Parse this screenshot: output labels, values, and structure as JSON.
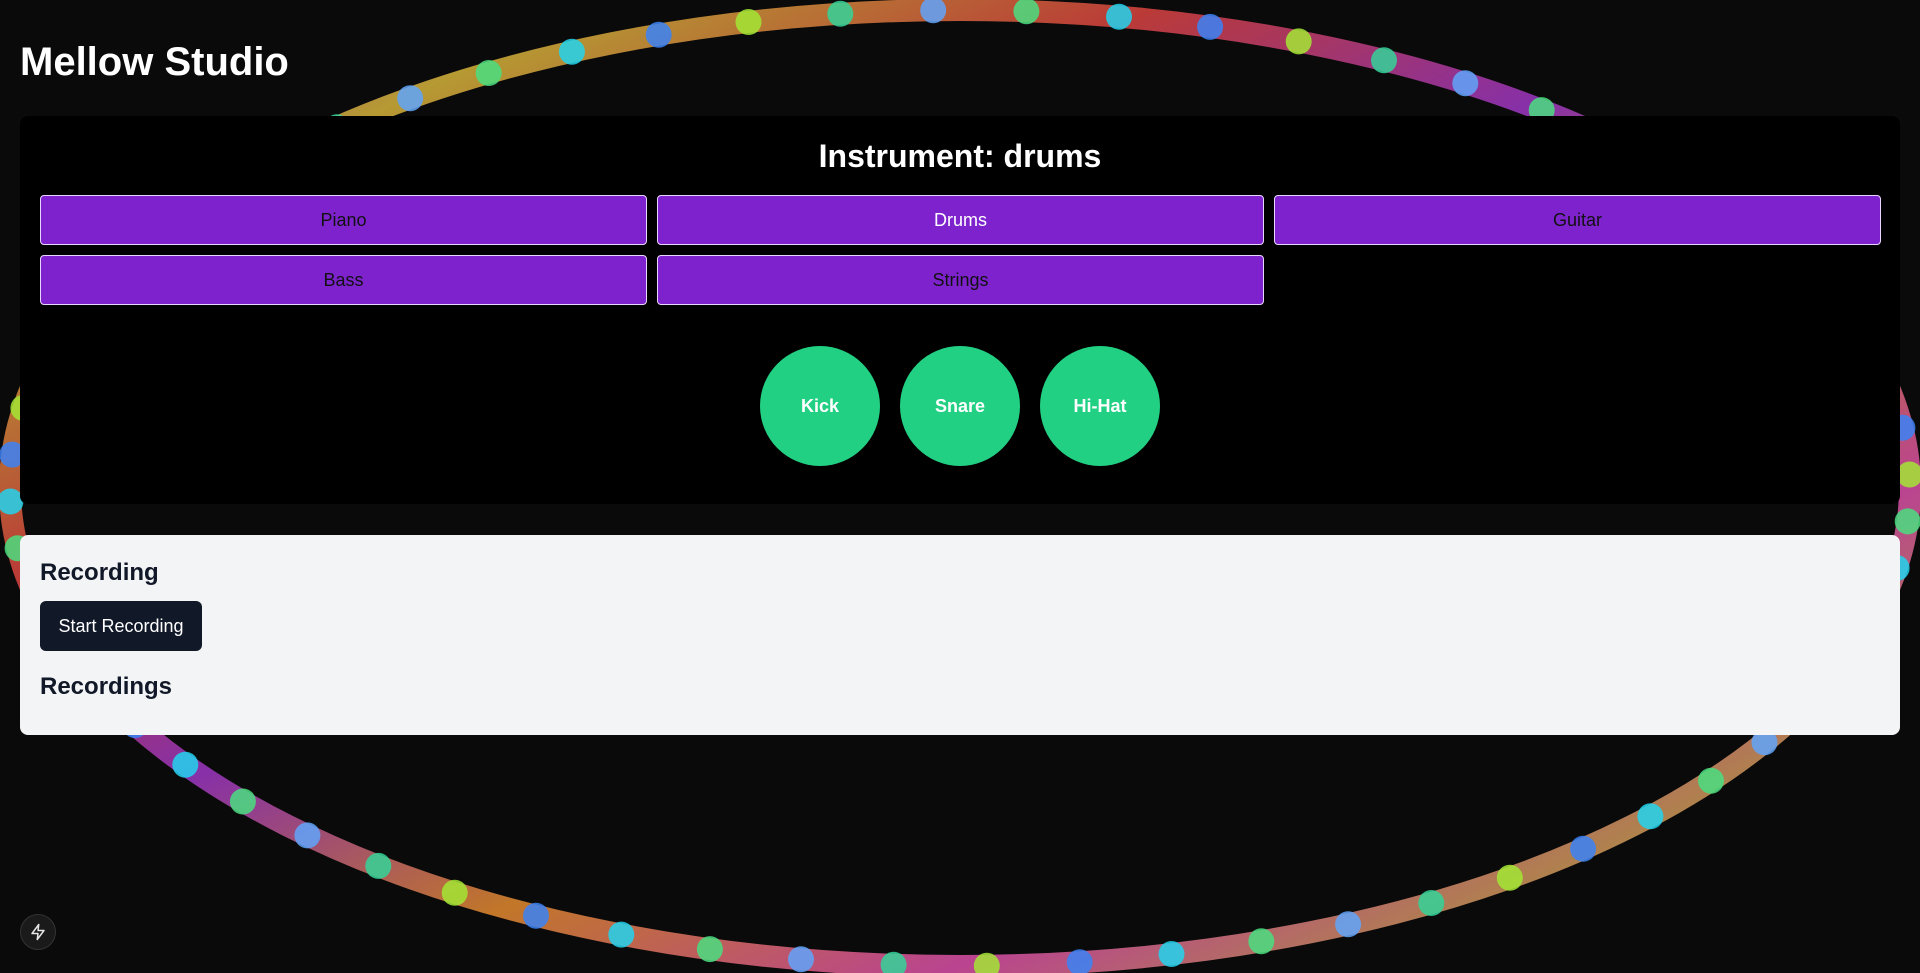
{
  "app": {
    "title": "Mellow Studio"
  },
  "instrument_panel": {
    "heading": "Instrument: drums",
    "selected": "Drums",
    "buttons": [
      {
        "label": "Piano"
      },
      {
        "label": "Drums"
      },
      {
        "label": "Guitar"
      },
      {
        "label": "Bass"
      },
      {
        "label": "Strings"
      }
    ],
    "pads": [
      {
        "label": "Kick"
      },
      {
        "label": "Snare"
      },
      {
        "label": "Hi-Hat"
      }
    ]
  },
  "recording": {
    "heading": "Recording",
    "start_label": "Start Recording",
    "recordings_heading": "Recordings",
    "recordings": []
  },
  "dev_tools": {
    "icon": "lightning-bolt-icon"
  },
  "colors": {
    "background": "#0a0a0a",
    "panel": "#000000",
    "accent_purple": "#7e22ce",
    "pad_green": "#22d083",
    "light_panel": "#f3f4f6",
    "dark_button": "#111827"
  }
}
